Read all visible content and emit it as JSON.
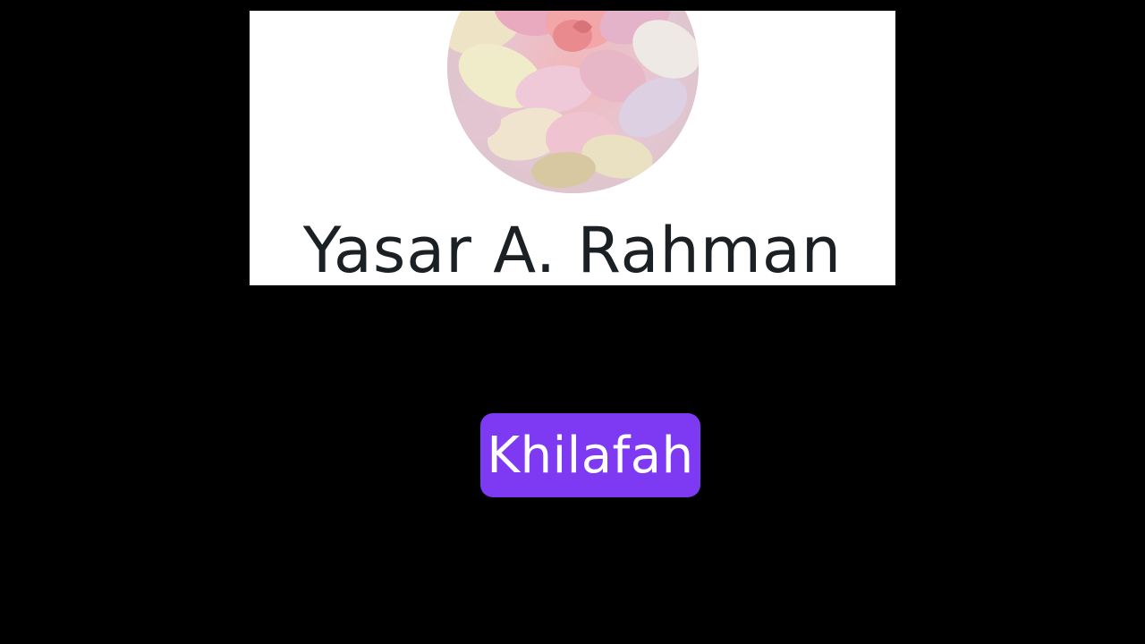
{
  "profile": {
    "name": "Yasar A. Rahman",
    "avatar_icon": "rose-petals-avatar"
  },
  "caption": {
    "text": "Khilafah",
    "background_color": "#7e3af2"
  },
  "colors": {
    "page_background": "#000000",
    "card_background": "#ffffff",
    "name_text": "#1b2024",
    "caption_text": "#ffffff"
  }
}
